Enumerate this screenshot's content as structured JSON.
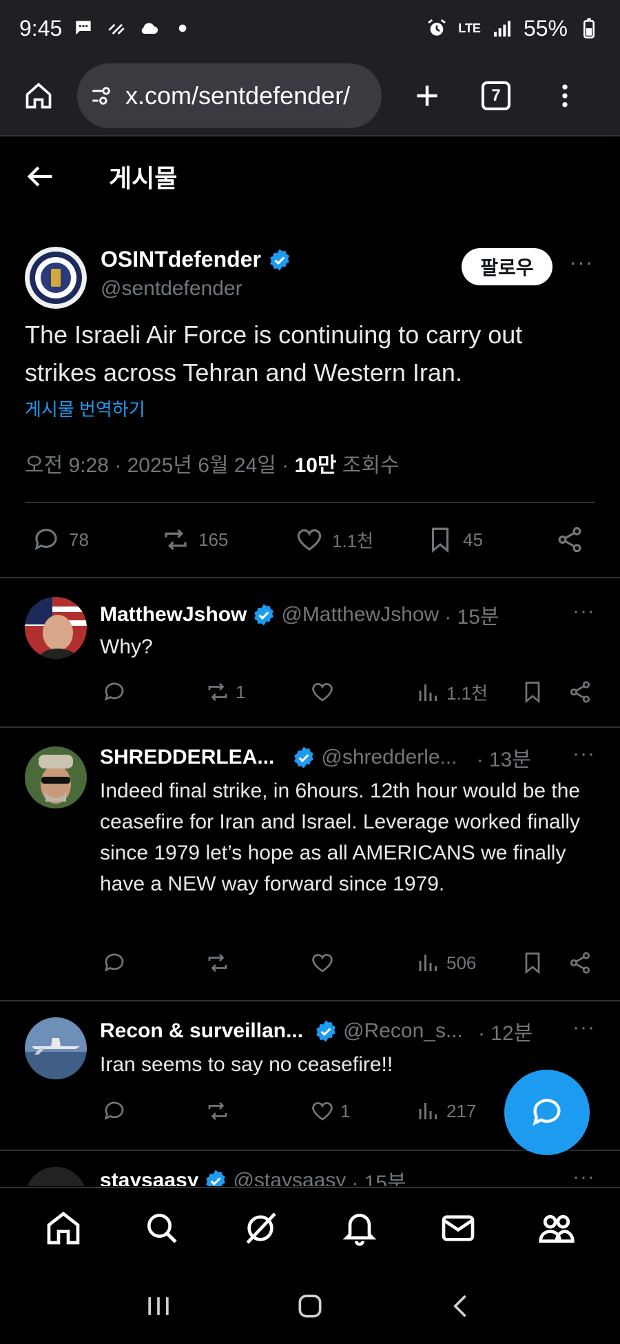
{
  "status_bar": {
    "time": "9:45",
    "battery": "55%",
    "network": "LTE"
  },
  "browser": {
    "url": "x.com/sentdefender/",
    "tab_count": "7"
  },
  "header": {
    "title": "게시물"
  },
  "main_post": {
    "name": "OSINTdefender",
    "handle": "@sentdefender",
    "follow_label": "팔로우",
    "text": "The Israeli Air Force is continuing to carry out strikes across Tehran and Western Iran.",
    "translate": "게시물 번역하기",
    "timestamp": "오전 9:28 · 2025년 6월 24일 · ",
    "views_count": "10만",
    "views_label": " 조회수",
    "replies": "78",
    "reposts": "165",
    "likes": "1.1천",
    "bookmarks": "45"
  },
  "replies": [
    {
      "name": "MatthewJshow",
      "handle": "@MatthewJshow",
      "time": "· 15분",
      "text": "Why?",
      "reposts": "1",
      "likes": "",
      "views": "1.1천"
    },
    {
      "name": "SHREDDERLEA...",
      "handle": "@shredderle...",
      "time": "· 13분",
      "text": "Indeed final strike, in 6hours.  12th hour would be the ceasefire for Iran and Israel.  Leverage worked finally since 1979 let’s hope as all AMERICANS we finally have a NEW way forward since 1979.",
      "reposts": "",
      "likes": "",
      "views": "506"
    },
    {
      "name": "Recon & surveillan...",
      "handle": "@Recon_s...",
      "time": "· 12분",
      "text": "Iran seems to say no ceasefire!!",
      "reposts": "",
      "likes": "1",
      "views": "217"
    },
    {
      "name": "staysaasy",
      "handle": "@staysaasy",
      "time": "· 15분"
    }
  ],
  "colors": {
    "accent": "#1d9bf0",
    "background": "#000000",
    "muted": "#71767b",
    "divider": "#2f3336"
  }
}
